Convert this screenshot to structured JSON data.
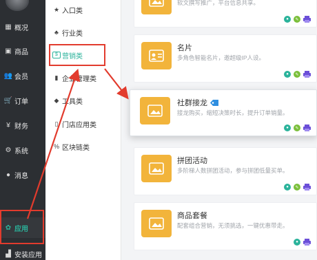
{
  "sidebar": {
    "items": [
      {
        "label": "概况",
        "icon": "overview-icon",
        "glyph": "▦"
      },
      {
        "label": "商品",
        "icon": "goods-icon",
        "glyph": "▣"
      },
      {
        "label": "会员",
        "icon": "members-icon",
        "glyph": "👥"
      },
      {
        "label": "订单",
        "icon": "cart-icon",
        "glyph": "🛒"
      },
      {
        "label": "财务",
        "icon": "yen-icon",
        "glyph": "¥"
      },
      {
        "label": "系统",
        "icon": "gear-icon",
        "glyph": "⚙"
      },
      {
        "label": "消息",
        "icon": "chat-icon",
        "glyph": "●"
      },
      {
        "label": "应用",
        "icon": "apps-icon",
        "glyph": "✿"
      },
      {
        "label": "安装应用",
        "icon": "install-icon",
        "glyph": "▟"
      }
    ]
  },
  "categories": {
    "items": [
      {
        "label": "入口类",
        "icon": "star-icon",
        "glyph": "★"
      },
      {
        "label": "行业类",
        "icon": "sitemap-icon",
        "glyph": "♣"
      },
      {
        "label": "营销类",
        "icon": "marketing-icon",
        "glyph": "$"
      },
      {
        "label": "企业管理类",
        "icon": "briefcase-icon",
        "glyph": "▮"
      },
      {
        "label": "工具类",
        "icon": "tag-icon",
        "glyph": "◆"
      },
      {
        "label": "门店应用类",
        "icon": "store-icon",
        "glyph": "▯"
      },
      {
        "label": "区块链类",
        "icon": "link-icon",
        "glyph": "%"
      }
    ]
  },
  "cards": [
    {
      "title": "",
      "desc": "软文撰写推广，平台信息共享。",
      "badge": ""
    },
    {
      "title": "名片",
      "desc": "多角色智能名片，邀超级IP人设。",
      "badge": ""
    },
    {
      "title": "社群接龙",
      "desc": "接龙购买，缩短决策时长，提升订单销量。",
      "badge": "tag"
    },
    {
      "title": "拼团活动",
      "desc": "多阶梯人数拼团活动，参与拼团低量买单。",
      "badge": ""
    },
    {
      "title": "商品套餐",
      "desc": "配套组合营销，无须挑选，一键优惠带走。",
      "badge": ""
    }
  ],
  "colors": {
    "accent": "#2bb39b",
    "tile": "#f2b43b",
    "highlight": "#e23b2d",
    "sidebar": "#2c2f33"
  }
}
